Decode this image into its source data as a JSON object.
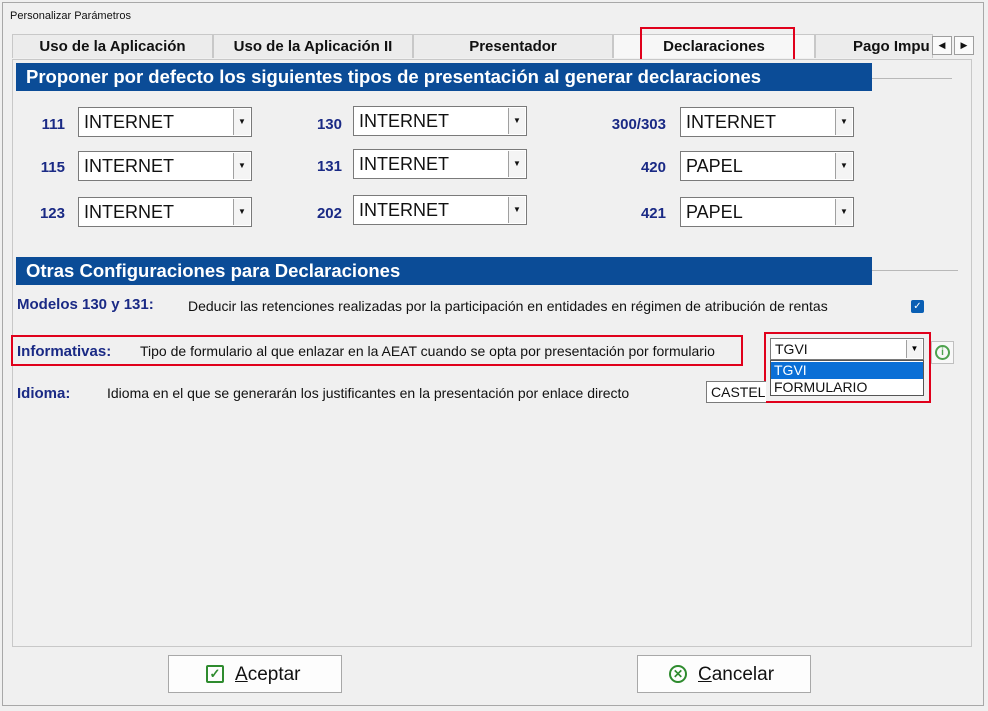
{
  "window": {
    "title": "Personalizar Parámetros"
  },
  "tabs": [
    {
      "label": "Uso de la Aplicación"
    },
    {
      "label": "Uso de la Aplicación II"
    },
    {
      "label": "Presentador"
    },
    {
      "label": "Declaraciones"
    },
    {
      "label": "Pago Impu"
    }
  ],
  "tab_scroll": {
    "left": "◀",
    "right": "▶"
  },
  "section1": {
    "title": "Proponer por defecto los siguientes tipos de presentación al generar declaraciones"
  },
  "models": [
    {
      "code": "111",
      "value": "INTERNET"
    },
    {
      "code": "115",
      "value": "INTERNET"
    },
    {
      "code": "123",
      "value": "INTERNET"
    },
    {
      "code": "130",
      "value": "INTERNET"
    },
    {
      "code": "131",
      "value": "INTERNET"
    },
    {
      "code": "202",
      "value": "INTERNET"
    },
    {
      "code": "300/303",
      "value": "INTERNET"
    },
    {
      "code": "420",
      "value": "PAPEL"
    },
    {
      "code": "421",
      "value": "PAPEL"
    }
  ],
  "section2": {
    "title": "Otras Configuraciones para Declaraciones"
  },
  "modelos130": {
    "label": "Modelos 130 y 131:",
    "description": "Deducir las retenciones realizadas por la participación en entidades en régimen de atribución de rentas",
    "checked": true,
    "check_glyph": "✓"
  },
  "informativas": {
    "label": "Informativas:",
    "description": "Tipo de formulario al que enlazar en la AEAT cuando se opta por presentación por formulario",
    "value": "TGVI",
    "options": [
      "TGVI",
      "FORMULARIO"
    ],
    "info_glyph": "i"
  },
  "idioma": {
    "label": "Idioma:",
    "description": "Idioma en el que se generarán los justificantes en la presentación por enlace directo",
    "value_visible": "CASTEL"
  },
  "buttons": {
    "accept_prefix": "A",
    "accept_rest": "ceptar",
    "accept_glyph": "✓",
    "cancel_prefix": "C",
    "cancel_rest": "ancelar",
    "cancel_glyph": "✕"
  },
  "colors": {
    "section_bg": "#0b4c97",
    "label": "#1a2a85",
    "highlight": "#e0001b",
    "accent_green": "#2e8b2e",
    "selection": "#0a6fd6"
  },
  "icons": [
    "check-icon",
    "cancel-icon",
    "info-icon",
    "dropdown-arrow-icon",
    "tab-scroll-left-icon",
    "tab-scroll-right-icon"
  ]
}
